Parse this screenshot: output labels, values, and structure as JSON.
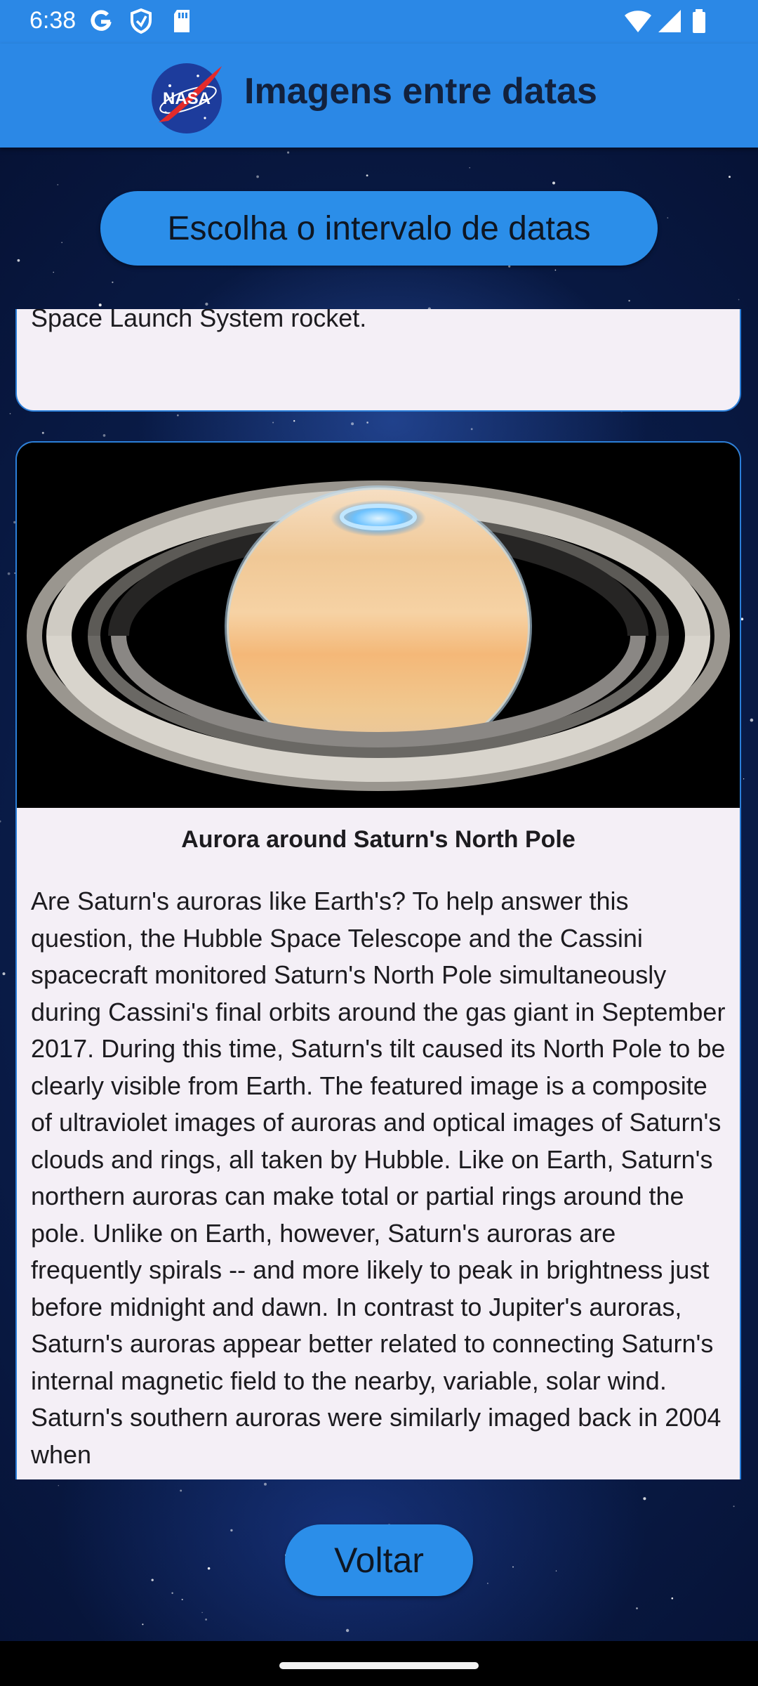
{
  "status_bar": {
    "time": "6:38",
    "icons": [
      "google-icon",
      "shield-icon",
      "sd-card-icon",
      "wifi-icon",
      "signal-icon",
      "battery-icon"
    ]
  },
  "app_bar": {
    "logo_text": "NASA",
    "title": "Imagens entre datas"
  },
  "pick_range_button": "Escolha o intervalo de datas",
  "cards": [
    {
      "description": "Artemis I mission. The Artemis I uncrewed mission to the Moon and back again launched in November 2022 on a Space Launch System rocket."
    },
    {
      "image_icon": "saturn-image",
      "title": "Aurora around Saturn's North Pole",
      "description": "Are Saturn's auroras like Earth's?  To help answer this question, the Hubble Space Telescope and the Cassini spacecraft monitored Saturn's North Pole simultaneously during Cassini's final orbits around the gas giant in September 2017.  During this time, Saturn's tilt caused its North Pole to be clearly visible from Earth. The featured image is a composite of ultraviolet images of auroras and optical images of Saturn's clouds and rings, all taken by Hubble.  Like on Earth, Saturn's northern auroras can make total or partial rings around the pole. Unlike on Earth, however, Saturn's auroras are frequently spirals -- and more likely to peak in brightness just before midnight and dawn.  In contrast to Jupiter's auroras, Saturn's auroras appear better related to connecting Saturn's internal magnetic field to the nearby, variable, solar wind.  Saturn's southern auroras were similarly imaged back in 2004 when"
    }
  ],
  "back_button": "Voltar",
  "colors": {
    "app_bar": "#2b88e6",
    "button": "#2b8ee9",
    "card_background": "#f4eff6",
    "card_border": "#2b7fd9"
  }
}
